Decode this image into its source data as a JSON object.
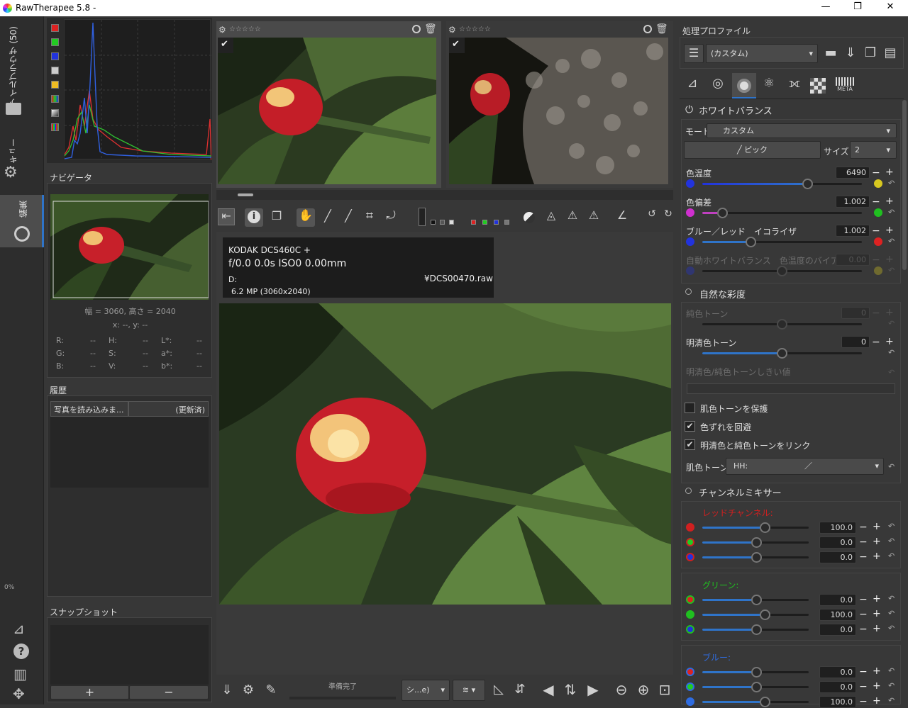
{
  "window": {
    "title": "RawTherapee 5.8 -",
    "minimize": "—",
    "maximize": "❐",
    "close": "✕"
  },
  "vtabs": {
    "file_browser": "ファイルブラウザ (50)",
    "queue": "キュー",
    "edit": "編集",
    "zoom_pct": "0%"
  },
  "navigator": {
    "title": "ナビゲータ",
    "dims": "幅 = 3060, 高さ = 2040",
    "xy": "x: --, y: --",
    "readouts": [
      {
        "l": "R:",
        "v": "--"
      },
      {
        "l": "H:",
        "v": "--"
      },
      {
        "l": "L*:",
        "v": "--"
      },
      {
        "l": "G:",
        "v": "--"
      },
      {
        "l": "S:",
        "v": "--"
      },
      {
        "l": "a*:",
        "v": "--"
      },
      {
        "l": "B:",
        "v": "--"
      },
      {
        "l": "V:",
        "v": "--"
      },
      {
        "l": "b*:",
        "v": "--"
      }
    ]
  },
  "history": {
    "title": "履歴",
    "col1": "写真を読み込みま...",
    "col2": "(更新済)"
  },
  "snapshot": {
    "title": "スナップショット",
    "add": "+",
    "remove": "−"
  },
  "filmstrip": {
    "stars": "☆☆☆☆☆",
    "check": "✔"
  },
  "info": {
    "camera": "KODAK DCS460C  +",
    "exposure": "f/0.0  0.0s  ISO0  0.00mm",
    "d_label": "D:",
    "filename": "¥DCS00470.raw",
    "mp": "6.2 MP (3060x2040)"
  },
  "bottombar": {
    "status": "準備完了",
    "profile_select": "シ...e)"
  },
  "right": {
    "profile_title": "処理プロファイル",
    "profile_value": "(カスタム)",
    "wb": {
      "title": "ホワイトバランス",
      "mode_label": "モード:",
      "mode_value": "カスタム",
      "pick": "ピック",
      "size_label": "サイズ:",
      "size_value": "2",
      "temp_label": "色温度",
      "temp_value": "6490",
      "tint_label": "色偏差",
      "tint_value": "1.002",
      "blue_red_label": "ブルー／レッド　イコライザ",
      "blue_red_value": "1.002",
      "auto_label": "自動ホワイトバランス　色温度のバイアス",
      "auto_value": "0.00"
    },
    "vibrance": {
      "title": "自然な彩度",
      "pastel_label": "純色トーン",
      "pastel_value": "0",
      "saturated_label": "明清色トーン",
      "saturated_value": "0",
      "threshold_label": "明清色/純色トーンしきい値",
      "protect_skin": "肌色トーンを保護",
      "avoid_shift": "色ずれを回避",
      "link": "明清色と純色トーンをリンク",
      "skin_label": "肌色トーン:",
      "skin_value": "HH:"
    },
    "mixer": {
      "title": "チャンネルミキサー",
      "red_label": "レッドチャンネル:",
      "green_label": "グリーン:",
      "blue_label": "ブルー:",
      "red_vals": [
        "100.0",
        "0.0",
        "0.0"
      ],
      "green_vals": [
        "0.0",
        "100.0",
        "0.0"
      ],
      "blue_vals": [
        "0.0",
        "0.0",
        "100.0"
      ]
    }
  },
  "colors": {
    "accent": "#2f74c9",
    "active_tab": "#4d4d4d"
  }
}
